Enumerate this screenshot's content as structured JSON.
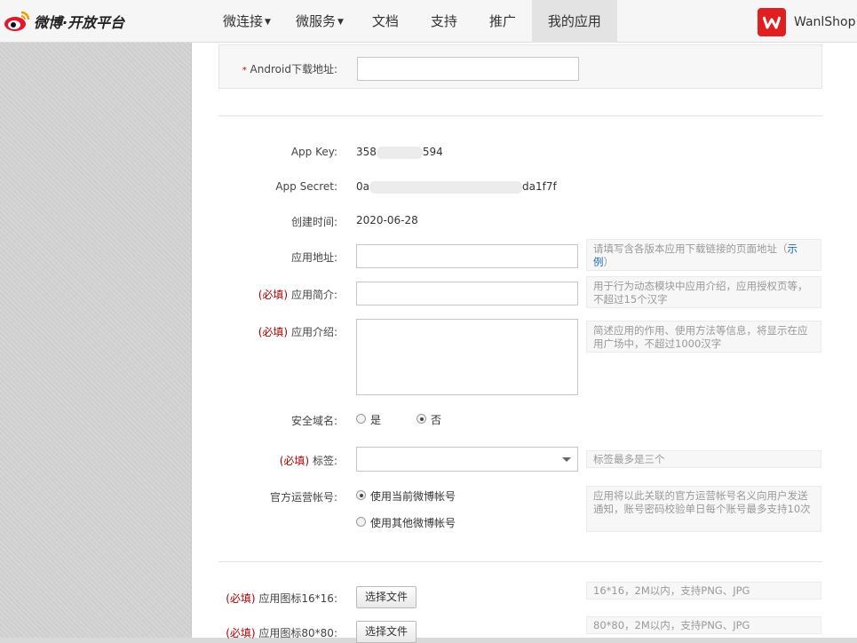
{
  "header": {
    "logo_text": "微博·开放平台",
    "nav": [
      {
        "label": "微连接",
        "caret": true
      },
      {
        "label": "微服务",
        "caret": true
      },
      {
        "label": "文档",
        "caret": false
      },
      {
        "label": "支持",
        "caret": false
      },
      {
        "label": "推广",
        "caret": false
      },
      {
        "label": "我的应用",
        "caret": false,
        "active": true
      }
    ],
    "username": "WanlShop",
    "avatar_color": "#e02020"
  },
  "form": {
    "android_download": {
      "label": "Android下载地址:",
      "required_mark": "*",
      "value": ""
    },
    "app_key": {
      "label": "App Key:",
      "value_prefix": "358",
      "value_suffix": "594"
    },
    "app_secret": {
      "label": "App Secret:",
      "value_prefix": "0a",
      "value_suffix": "da1f7f"
    },
    "created": {
      "label": "创建时间:",
      "value": "2020-06-28"
    },
    "app_url": {
      "label": "应用地址:",
      "value": "",
      "hint": "请填写含各版本应用下载链接的页面地址（",
      "hint_link": "示例",
      "hint_end": "）"
    },
    "app_brief": {
      "required": "(必填)",
      "label": "应用简介:",
      "value": "",
      "hint": "用于行为动态模块中应用介绍，应用授权页等，不超过15个汉字"
    },
    "app_intro": {
      "required": "(必填)",
      "label": "应用介绍:",
      "value": "",
      "hint": "简述应用的作用、使用方法等信息，将显示在应用广场中，不超过1000汉字"
    },
    "secure_domain": {
      "label": "安全域名:",
      "options": [
        "是",
        "否"
      ],
      "selected": "否"
    },
    "tags": {
      "required": "(必填)",
      "label": "标签:",
      "value": "",
      "hint": "标签最多是三个"
    },
    "official_account": {
      "label": "官方运营帐号:",
      "options": [
        "使用当前微博帐号",
        "使用其他微博帐号"
      ],
      "selected": "使用当前微博帐号",
      "hint": "应用将以此关联的官方运营帐号名义向用户发送通知，账号密码校验单日每个账号最多支持10次"
    },
    "icon16": {
      "required": "(必填)",
      "label": "应用图标16*16:",
      "button": "选择文件",
      "hint": "16*16，2M以内，支持PNG、JPG"
    },
    "icon80": {
      "required": "(必填)",
      "label": "应用图标80*80:",
      "button": "选择文件",
      "hint": "80*80，2M以内，支持PNG、JPG"
    }
  }
}
